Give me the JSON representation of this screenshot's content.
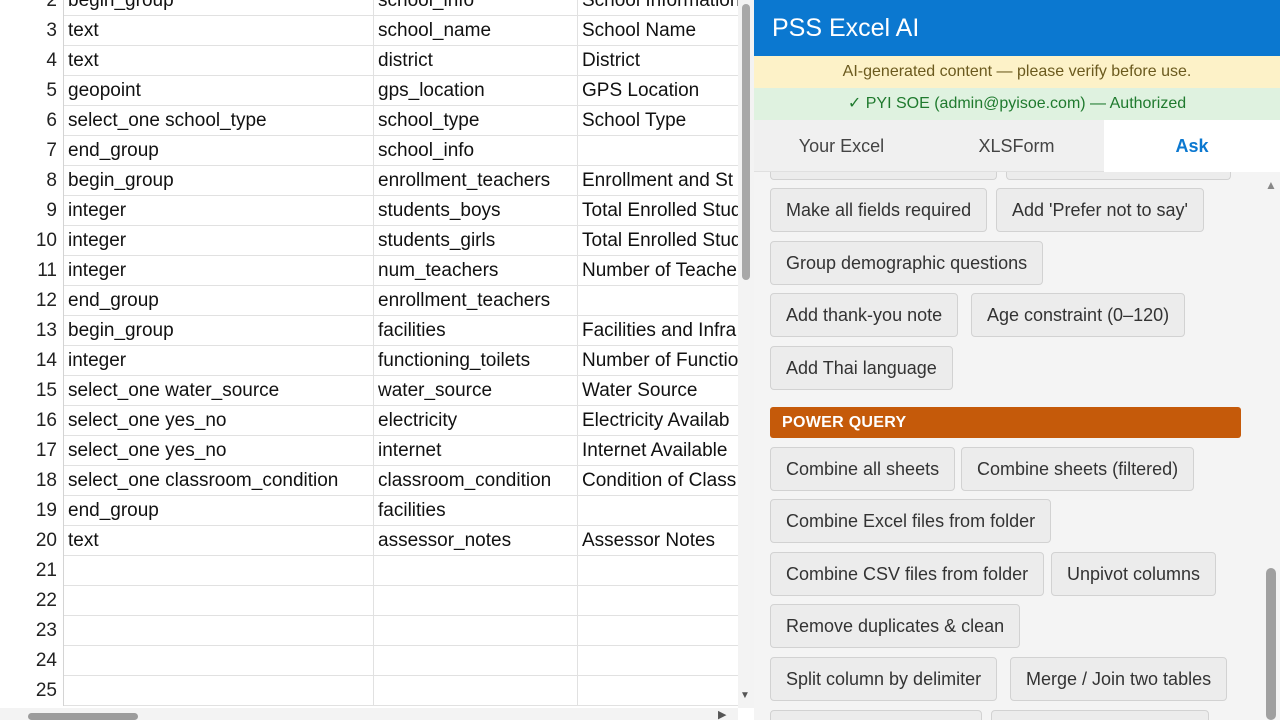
{
  "sheet": {
    "rows": [
      {
        "num": "2",
        "a": "begin_group",
        "b": "school_info",
        "c": "School Information"
      },
      {
        "num": "3",
        "a": "text",
        "b": "school_name",
        "c": "School Name"
      },
      {
        "num": "4",
        "a": "text",
        "b": "district",
        "c": "District"
      },
      {
        "num": "5",
        "a": "geopoint",
        "b": "gps_location",
        "c": "GPS Location"
      },
      {
        "num": "6",
        "a": "select_one school_type",
        "b": "school_type",
        "c": "School Type"
      },
      {
        "num": "7",
        "a": "end_group",
        "b": "school_info",
        "c": ""
      },
      {
        "num": "8",
        "a": "begin_group",
        "b": "enrollment_teachers",
        "c": "Enrollment and St"
      },
      {
        "num": "9",
        "a": "integer",
        "b": "students_boys",
        "c": "Total Enrolled Stud"
      },
      {
        "num": "10",
        "a": "integer",
        "b": "students_girls",
        "c": "Total Enrolled Stud"
      },
      {
        "num": "11",
        "a": "integer",
        "b": "num_teachers",
        "c": "Number of Teache"
      },
      {
        "num": "12",
        "a": "end_group",
        "b": "enrollment_teachers",
        "c": ""
      },
      {
        "num": "13",
        "a": "begin_group",
        "b": "facilities",
        "c": "Facilities and Infra"
      },
      {
        "num": "14",
        "a": "integer",
        "b": "functioning_toilets",
        "c": "Number of Functio"
      },
      {
        "num": "15",
        "a": "select_one water_source",
        "b": "water_source",
        "c": "Water Source"
      },
      {
        "num": "16",
        "a": "select_one yes_no",
        "b": "electricity",
        "c": "Electricity Availab"
      },
      {
        "num": "17",
        "a": "select_one yes_no",
        "b": "internet",
        "c": "Internet Available"
      },
      {
        "num": "18",
        "a": "select_one classroom_condition",
        "b": "classroom_condition",
        "c": "Condition of Class"
      },
      {
        "num": "19",
        "a": "end_group",
        "b": "facilities",
        "c": ""
      },
      {
        "num": "20",
        "a": "text",
        "b": "assessor_notes",
        "c": "Assessor Notes"
      },
      {
        "num": "21",
        "a": "",
        "b": "",
        "c": ""
      },
      {
        "num": "22",
        "a": "",
        "b": "",
        "c": ""
      },
      {
        "num": "23",
        "a": "",
        "b": "",
        "c": ""
      },
      {
        "num": "24",
        "a": "",
        "b": "",
        "c": ""
      },
      {
        "num": "25",
        "a": "",
        "b": "",
        "c": ""
      }
    ]
  },
  "pane": {
    "title": "PSS Excel AI",
    "ai_notice": "AI-generated content — please verify before use.",
    "auth_notice": "✓ PYI SOE (admin@pyisoe.com) — Authorized",
    "tabs": {
      "your_excel": "Your Excel",
      "xlsform": "XLSForm",
      "ask": "Ask"
    },
    "buttons": {
      "make_required": "Make all fields required",
      "prefer_not": "Add 'Prefer not to say'",
      "group_demo": "Group demographic questions",
      "thank_you": "Add thank-you note",
      "age_constraint": "Age constraint (0–120)",
      "thai_lang": "Add Thai language"
    },
    "power_query": {
      "header": "POWER QUERY",
      "combine_all": "Combine all sheets",
      "combine_filtered": "Combine sheets (filtered)",
      "combine_excel": "Combine Excel files from folder",
      "combine_csv": "Combine CSV files from folder",
      "unpivot": "Unpivot columns",
      "remove_dup": "Remove duplicates & clean",
      "split_col": "Split column by delimiter",
      "merge_join": "Merge / Join two tables"
    }
  },
  "colors": {
    "pane_header": "#0b78d0",
    "power_query": "#c55a0a",
    "auth_green": "#1f7a2e",
    "notice_yellow": "#fdf2c8"
  }
}
